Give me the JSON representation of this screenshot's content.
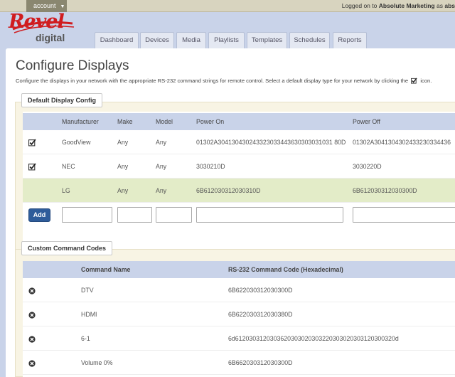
{
  "topbar": {
    "account_label": "account",
    "logged_prefix": "Logged on to",
    "logged_org": "Absolute Marketing",
    "logged_suffix": "as",
    "logged_user": "abs"
  },
  "brand": {
    "name": "Revel",
    "sub": "digital"
  },
  "nav": {
    "tabs": [
      "Dashboard",
      "Devices",
      "Media",
      "Playlists",
      "Templates",
      "Schedules",
      "Reports"
    ]
  },
  "page": {
    "title": "Configure Displays",
    "subtitle_before": "Configure the displays in your network with the appropriate RS-232 command strings for remote control. Select a default display type for your network by clicking the",
    "subtitle_after": "icon."
  },
  "default_config": {
    "legend": "Default Display Config",
    "columns": [
      "Manufacturer",
      "Make",
      "Model",
      "Power On",
      "Power Off"
    ],
    "rows": [
      {
        "checked": true,
        "manufacturer": "GoodView",
        "make": "Any",
        "model": "Any",
        "power_on": "01302A304130430243323033443630303031031 80D",
        "power_off": "01302A3041304302433230334436"
      },
      {
        "checked": true,
        "manufacturer": "NEC",
        "make": "Any",
        "model": "Any",
        "power_on": "3030210D",
        "power_off": "3030220D"
      },
      {
        "checked": false,
        "manufacturer": "LG",
        "make": "Any",
        "model": "Any",
        "power_on": "6B612030312030310D",
        "power_off": "6B612030312030300D"
      }
    ],
    "add_label": "Add"
  },
  "custom_codes": {
    "legend": "Custom Command Codes",
    "columns": [
      "Command Name",
      "RS-232 Command Code (Hexadecimal)"
    ],
    "rows": [
      {
        "name": "DTV",
        "code": "6B622030312030300D"
      },
      {
        "name": "HDMI",
        "code": "6B622030312030380D"
      },
      {
        "name": "6-1",
        "code": "6d6120303120303620303020303220303020303120300320d"
      },
      {
        "name": "Volume 0%",
        "code": "6B662030312030300D"
      }
    ]
  },
  "colors": {
    "brand_red": "#d01c1f",
    "header_bg": "#c9d3e9",
    "add_button": "#2e5c9a",
    "highlight_row": "#e3ecc8"
  }
}
